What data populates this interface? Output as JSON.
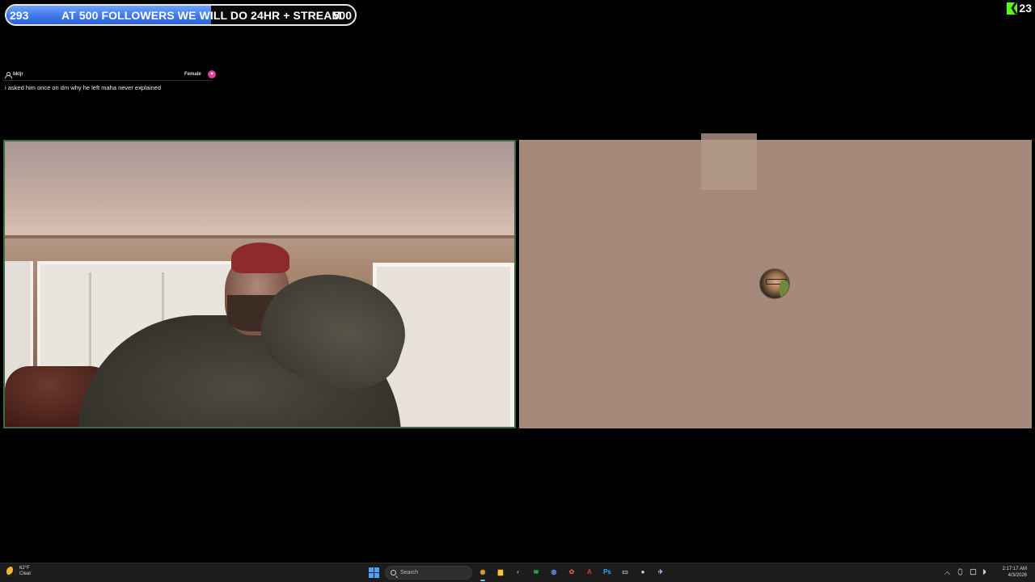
{
  "goal": {
    "current": "293",
    "text": "AT 500 FOLLOWERS WE WILL DO 24HR + STREAM",
    "target": "500",
    "progress_fraction": 0.586
  },
  "kick": {
    "viewer_count": "23",
    "brand_color": "#53fc18"
  },
  "chat": {
    "username": "bkljr",
    "gender": "Female",
    "message": "i asked him once on dm why he left maha never explained"
  },
  "taskbar": {
    "weather": {
      "temp": "62°F",
      "condition": "Clear"
    },
    "search_placeholder": "Search",
    "apps": [
      {
        "name": "chrome",
        "glyph": "◉",
        "color": "#e8a23a",
        "active": true
      },
      {
        "name": "file-explorer",
        "glyph": "▆",
        "color": "#f3c43c",
        "active": false
      },
      {
        "name": "edge",
        "glyph": "◐",
        "color": "#2ea0e0",
        "active": false
      },
      {
        "name": "spotify",
        "glyph": "≋",
        "color": "#1ed760",
        "active": false
      },
      {
        "name": "discord",
        "glyph": "◍",
        "color": "#7b86f2",
        "active": false
      },
      {
        "name": "app-red",
        "glyph": "✿",
        "color": "#e2504a",
        "active": false
      },
      {
        "name": "acrobat",
        "glyph": "A",
        "color": "#d33b36",
        "active": false
      },
      {
        "name": "photoshop",
        "glyph": "Ps",
        "color": "#31a8ff",
        "active": false
      },
      {
        "name": "terminal",
        "glyph": "▭",
        "color": "#cccccc",
        "active": false
      },
      {
        "name": "obs",
        "glyph": "●",
        "color": "#d8d8d8",
        "active": false
      },
      {
        "name": "steam",
        "glyph": "✈",
        "color": "#9ec4e8",
        "active": false
      }
    ],
    "clock": {
      "time": "2:17:17 AM",
      "date": "4/3/2026"
    }
  }
}
